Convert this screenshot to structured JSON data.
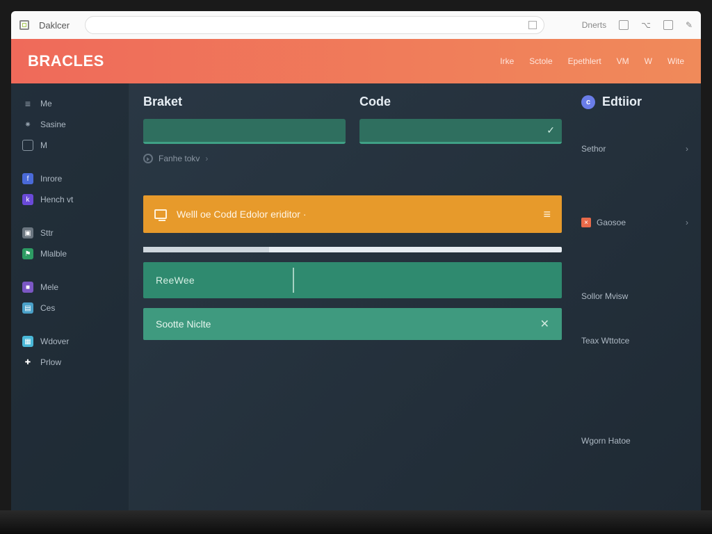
{
  "chrome": {
    "tab_label": "Daklcer",
    "right_label": "Dnerts"
  },
  "header": {
    "brand": "Bracles",
    "menu": [
      "Irke",
      "Sctole",
      "Epethlert",
      "VM",
      "W",
      "Wite"
    ]
  },
  "sidebar": {
    "items": [
      {
        "label": "Me"
      },
      {
        "label": "Sasine"
      },
      {
        "label": "M"
      },
      {
        "label": "Inrore"
      },
      {
        "label": "Hench vt"
      },
      {
        "label": "Sttr"
      },
      {
        "label": "Mlalble"
      },
      {
        "label": "Mele"
      },
      {
        "label": "Ces"
      },
      {
        "label": "Wdover"
      },
      {
        "label": "Prlow"
      }
    ]
  },
  "main": {
    "col_a_title": "Braket",
    "col_b_title": "Code",
    "subtle_text": "Fanhe tokv",
    "banner_text": "Welll oe Codd Edolor eriditor ·",
    "block_a_label": "ReeWee",
    "block_b_label": "Sootte Niclte"
  },
  "rail": {
    "title": "Edtiior",
    "badge_letter": "c",
    "items": [
      {
        "label": "Sethor"
      },
      {
        "label": "Gaosoe"
      },
      {
        "label": "Sollor Mvisw"
      },
      {
        "label": "Teax Wttotce"
      },
      {
        "label": "Wgorn Hatoe"
      }
    ]
  },
  "colors": {
    "accent_orange": "#e79a2b",
    "accent_teal": "#2f8a6f",
    "header_grad_a": "#ef6a5a",
    "header_grad_b": "#f08a5a"
  }
}
